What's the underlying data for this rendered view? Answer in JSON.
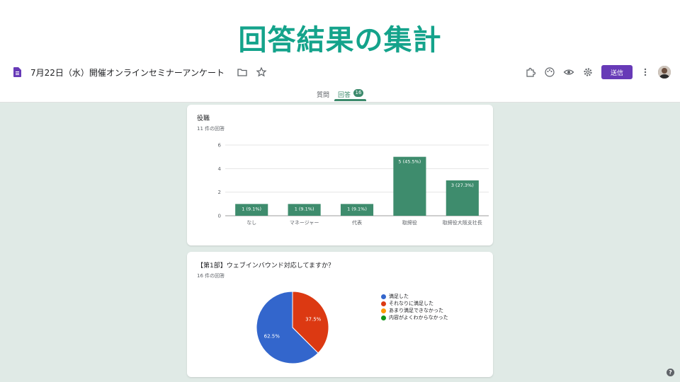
{
  "slide": {
    "title": "回答結果の集計"
  },
  "header": {
    "doc_title": "7月22日（水）開催オンラインセミナーアンケート",
    "send_label": "送信",
    "colors": {
      "accent": "#673ab7",
      "form_theme": "#3c8a6c"
    }
  },
  "tabs": {
    "questions_label": "質問",
    "responses_label": "回答",
    "responses_count": "16"
  },
  "cards": [
    {
      "title": "役職",
      "count_label": "11 件の回答"
    },
    {
      "title": "【第1部】ウェブインバウンド対応してますか？",
      "count_label": "16 件の回答"
    }
  ],
  "chart_data": [
    {
      "type": "bar",
      "title": "役職",
      "categories": [
        "なし",
        "マネージャー",
        "代表",
        "取締役",
        "取締役大阪支社長"
      ],
      "values": [
        1,
        1,
        1,
        5,
        3
      ],
      "value_labels": [
        "1 (9.1%)",
        "1 (9.1%)",
        "1 (9.1%)",
        "5 (45.5%)",
        "3 (27.3%)"
      ],
      "yticks": [
        0,
        2,
        4,
        6
      ],
      "ylim": [
        0,
        6
      ],
      "grid": true,
      "color": "#3e8c6d"
    },
    {
      "type": "pie",
      "title": "【第1部】ウェブインバウンド対応してますか？",
      "labels": [
        "満足した",
        "それなりに満足した",
        "あまり満足できなかった",
        "内容がよくわからなかった"
      ],
      "values": [
        62.5,
        37.5,
        0,
        0
      ],
      "slice_labels": [
        "62.5%",
        "37.5%"
      ],
      "colors": [
        "#3366cc",
        "#dc3912",
        "#ff9900",
        "#109618"
      ],
      "legend_position": "right"
    }
  ]
}
